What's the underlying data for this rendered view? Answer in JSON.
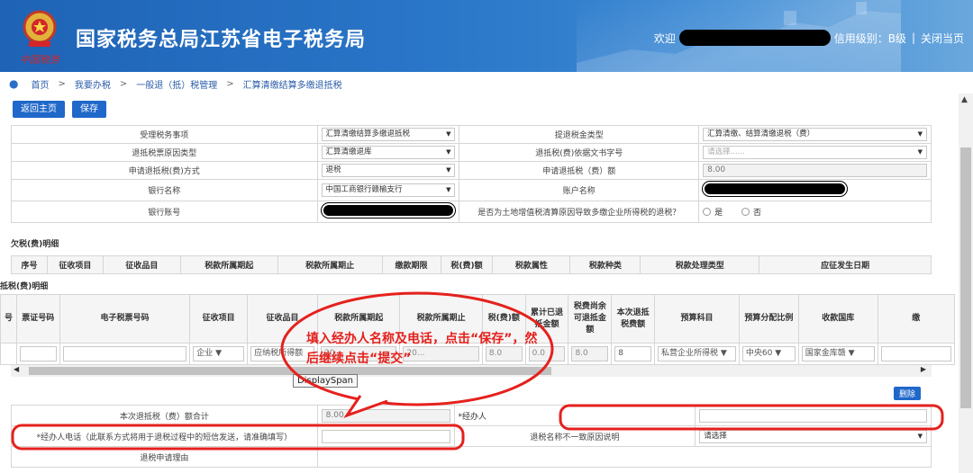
{
  "header": {
    "emblem_caption": "中国税务",
    "title": "国家税务总局江苏省电子税务局",
    "welcome": "欢迎",
    "credit_level": "信用级别：B级",
    "close_page": "关闭当页",
    "divider": "|"
  },
  "breadcrumb": [
    "首页",
    "我要办税",
    "一般退（抵）税管理",
    "汇算清缴结算多缴退抵税"
  ],
  "buttons": {
    "home": "返回主页",
    "save": "保存",
    "delete": "删除"
  },
  "form": {
    "rows": [
      [
        "受理税务事项",
        "汇算清缴结算多缴退抵税",
        "提退税金类型",
        "汇算清缴、结算清缴退税（费）"
      ],
      [
        "退抵税票原因类型",
        "汇算清缴退库",
        "退抵税(费)依据文书字号",
        "请选择......"
      ],
      [
        "申请退抵税(费)方式",
        "退税",
        "申请退抵税（费）额",
        "8.00"
      ],
      [
        "银行名称",
        "中国工商银行赣榆支行",
        "账户名称",
        ""
      ],
      [
        "银行账号",
        "",
        "是否为土地增值税清算原因导致多缴企业所得税的退税？",
        ""
      ]
    ],
    "radio_yes": "是",
    "radio_no": "否"
  },
  "owed": {
    "title": "欠税(费)明细",
    "headers": [
      "序号",
      "征收项目",
      "征收品目",
      "税款所属期起",
      "税款所属期止",
      "缴款期限",
      "税(费)额",
      "税款属性",
      "税款种类",
      "税款处理类型",
      "应征发生日期"
    ]
  },
  "refund": {
    "title": "抵税(费)明细",
    "headers": [
      "号",
      "票证号码",
      "电子税票号码",
      "征收项目",
      "征收品目",
      "税款所属期起",
      "税款所属期止",
      "税(费)额",
      "累计已退抵金额",
      "税费尚余可退抵金额",
      "本次退抵税费额",
      "预算科目",
      "预算分配比例",
      "收款国库",
      "缴"
    ],
    "row": [
      "",
      "",
      "",
      "企业",
      "应纳税所得额",
      "20...",
      "20...",
      "8.0",
      "0.0",
      "8.0",
      "8",
      "私营企业所得税",
      "中央60",
      "国家金库赣",
      ""
    ]
  },
  "tooltip": "DisplaySpan",
  "annotation": "填入经办人名称及电话，点击“保存”，然后继续点击“提交”",
  "bottom": {
    "total_label": "本次退抵税（费）额合计",
    "total_value": "8.00",
    "agent_label": "*经办人",
    "phone_label": "*经办人电话（此联系方式将用于退税过程中的短信发送，请准确填写）",
    "mismatch_label": "退税名称不一致原因说明",
    "mismatch_value": "请选择",
    "reason_label": "退税申请理由"
  },
  "colors": {
    "header_blue": "#1e63b6",
    "button_blue": "#2068c9",
    "annotation_red": "#e5211d"
  }
}
